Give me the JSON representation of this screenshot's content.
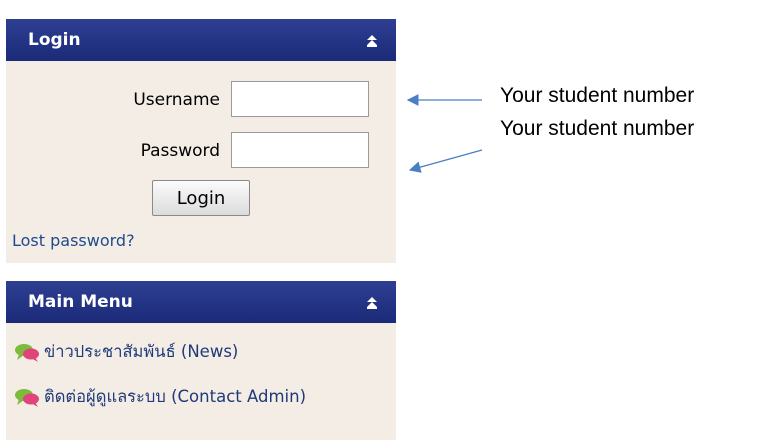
{
  "login_panel": {
    "title": "Login",
    "username_label": "Username",
    "username_value": "",
    "password_label": "Password",
    "password_value": "",
    "login_button": "Login",
    "lost_password": "Lost password?"
  },
  "main_menu": {
    "title": "Main Menu",
    "items": [
      {
        "label": "ข่าวประชาสัมพันธ์ (News)",
        "icon": "chat-bubbles-icon"
      },
      {
        "label": "ติดต่อผู้ดูแลระบบ (Contact Admin)",
        "icon": "chat-bubbles-icon"
      }
    ]
  },
  "annotations": {
    "username_note": "Your student number",
    "password_note": "Your student number"
  },
  "colors": {
    "header_bg": "#24358a",
    "panel_bg": "#f4ede6",
    "link": "#1f4a8c",
    "arrow": "#4a7fc1"
  }
}
